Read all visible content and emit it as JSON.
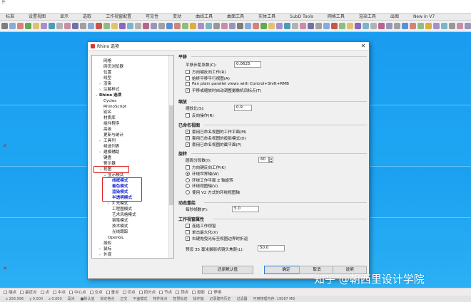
{
  "window": {
    "title_line1": "",
    "title_line2": "件"
  },
  "ribbon_tabs": [
    "标准",
    "设置视图",
    "显示",
    "选取",
    "工作视窗配置",
    "可见性",
    "变动",
    "曲线工具",
    "曲面工具",
    "实体工具",
    "SubD Tools",
    "网格工具",
    "渲染工具",
    "出图",
    "New in V7"
  ],
  "dialog": {
    "title": "Rhino 选项",
    "close_glyph": "✕",
    "tree": [
      {
        "label": "网格",
        "depth": 1
      },
      {
        "label": "网页浏览器",
        "depth": 1
      },
      {
        "label": "位置",
        "depth": 1
      },
      {
        "label": "线型",
        "depth": 1
      },
      {
        "label": "渲染",
        "depth": 1,
        "exp": "›"
      },
      {
        "label": "注解样式",
        "depth": 1,
        "exp": "›"
      },
      {
        "label": "Rhino 选项",
        "depth": 0,
        "bold": true,
        "exp": "⌄"
      },
      {
        "label": "Cycles",
        "depth": 1
      },
      {
        "label": "RhinoScript",
        "depth": 1
      },
      {
        "label": "别名",
        "depth": 1
      },
      {
        "label": "材质库",
        "depth": 1
      },
      {
        "label": "插件程序",
        "depth": 1
      },
      {
        "label": "高级",
        "depth": 1
      },
      {
        "label": "更新与统计",
        "depth": 1
      },
      {
        "label": "工具列",
        "depth": 1,
        "exp": "›"
      },
      {
        "label": "候选列表",
        "depth": 1
      },
      {
        "label": "建模辅助",
        "depth": 1,
        "exp": "›"
      },
      {
        "label": "键盘",
        "depth": 1
      },
      {
        "label": "警示器",
        "depth": 1
      },
      {
        "label": "视图",
        "depth": 1,
        "exp": "⌄",
        "hl": true
      },
      {
        "label": "显示模式",
        "depth": 2,
        "exp": "⌄"
      },
      {
        "label": "线框模式",
        "depth": 3,
        "blue": true
      },
      {
        "label": "着色模式",
        "depth": 3,
        "blue": true
      },
      {
        "label": "渲染模式",
        "depth": 3,
        "blue": true
      },
      {
        "label": "半透明模式",
        "depth": 3,
        "blue": true
      },
      {
        "label": "X 光模式",
        "depth": 3,
        "exp": "›"
      },
      {
        "label": "工程图模式",
        "depth": 3
      },
      {
        "label": "艺术风格模式",
        "depth": 3
      },
      {
        "label": "钢笔模式",
        "depth": 3
      },
      {
        "label": "技术模式",
        "depth": 3
      },
      {
        "label": "光线跟踪",
        "depth": 3
      },
      {
        "label": "OpenGL",
        "depth": 2
      },
      {
        "label": "授权",
        "depth": 1
      },
      {
        "label": "鼠标",
        "depth": 1,
        "exp": "›"
      },
      {
        "label": "外观",
        "depth": 1,
        "exp": "›"
      }
    ],
    "pan": {
      "heading": "平移",
      "step_label": "平移步距系数(C):",
      "step_value": "0.0625",
      "options": [
        {
          "label": "方向键反向工作(R)",
          "checked": false
        },
        {
          "label": "始终平移平行视图(A)",
          "checked": false
        },
        {
          "label": "Pan plain parallel views with Control+Shift+RMB",
          "checked": false
        },
        {
          "label": "平移或缩放时自动调整摄像机目标点(T)",
          "checked": true
        }
      ]
    },
    "zoom": {
      "heading": "缩放",
      "ratio_label": "缩放比(S):",
      "ratio_value": "0.9",
      "options": [
        {
          "label": "反向操作(R)",
          "checked": false
        }
      ]
    },
    "named_views": {
      "heading": "已命名视图",
      "options": [
        {
          "label": "套用已命名视图的工作平面(M)",
          "checked": true
        },
        {
          "label": "套用已命名视图的投影模式(D)",
          "checked": true
        },
        {
          "label": "套用已命名视图的截平面(P)",
          "checked": true
        }
      ]
    },
    "rotate": {
      "heading": "旋转",
      "circle_label": "圆周分段数(I):",
      "circle_value": "60",
      "reverse_label": "方向键反向工作(K)",
      "radios": [
        {
          "label": "环绕世界轴(W)",
          "on": true
        },
        {
          "label": "环绕工作平面 Z 轴旋转",
          "on": false
        },
        {
          "label": "环绕视图轴(V)",
          "on": false
        },
        {
          "label": "使用 V2 方式的环绕视图轴",
          "on": false
        }
      ]
    },
    "dynamic_redraw": {
      "heading": "动态重绘",
      "fps_label": "每秒帧数(F):",
      "fps_value": "5.0"
    },
    "viewport_props": {
      "heading": "工作视窗属性",
      "options": [
        {
          "label": "连结工作视窗",
          "checked": false
        },
        {
          "label": "单击最大化(X)",
          "checked": false
        },
        {
          "label": "右键拖曳光标至视图边界时折返",
          "checked": true
        }
      ],
      "lens_label": "预设 35 毫米摄影机镜头焦距(L):",
      "lens_value": "50.0"
    },
    "buttons": {
      "restore": "还原默认值",
      "ok": "确定",
      "cancel": "取消",
      "help": "说明"
    }
  },
  "osnap": [
    "端点",
    "最近点",
    "点",
    "中点",
    "中心点",
    "交点",
    "垂点",
    "切点",
    "四分点",
    "节点",
    "顶点",
    "投影",
    "停用"
  ],
  "status": [
    "x 256.996",
    "y 0.000",
    "z 0.000",
    "毫米",
    "■默认值",
    "锁定格点",
    "正交",
    "平面模式",
    "物件锁点",
    "智慧轨迹",
    "操作轴",
    "记录建构历史",
    "过滤器",
    "可用物理内存: 19587 MB"
  ],
  "watermark": "知乎 @朝西里设计学院",
  "colors": {
    "viewport": "#1ea0f0",
    "highlight": "#e02020",
    "link_blue": "#1a2ad0"
  }
}
